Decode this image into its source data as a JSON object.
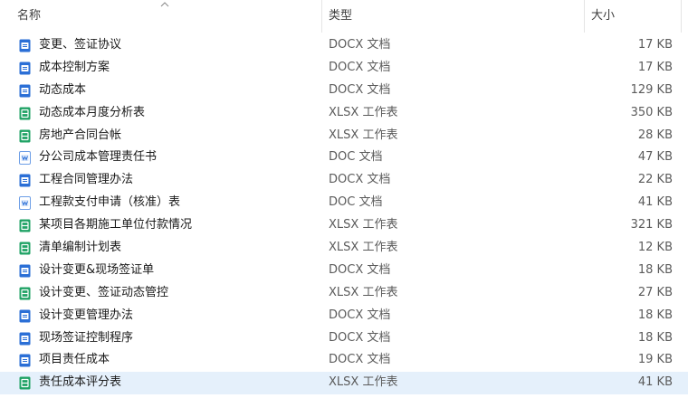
{
  "header": {
    "name_label": "名称",
    "type_label": "类型",
    "size_label": "大小",
    "sort": "ascending"
  },
  "colors": {
    "word": "#2b6fd6",
    "excel": "#21a366",
    "selected_row": "#e5f0fb"
  },
  "files": [
    {
      "name": "变更、签证协议",
      "type": "DOCX 文档",
      "size": "17 KB",
      "icon": "word-doc-icon"
    },
    {
      "name": "成本控制方案",
      "type": "DOCX 文档",
      "size": "17 KB",
      "icon": "word-doc-icon"
    },
    {
      "name": "动态成本",
      "type": "DOCX 文档",
      "size": "129 KB",
      "icon": "word-doc-icon"
    },
    {
      "name": "动态成本月度分析表",
      "type": "XLSX 工作表",
      "size": "350 KB",
      "icon": "excel-sheet-icon"
    },
    {
      "name": "房地产合同台帐",
      "type": "XLSX 工作表",
      "size": "28 KB",
      "icon": "excel-sheet-icon"
    },
    {
      "name": "分公司成本管理责任书",
      "type": "DOC 文档",
      "size": "47 KB",
      "icon": "word-doc-legacy-icon"
    },
    {
      "name": "工程合同管理办法",
      "type": "DOCX 文档",
      "size": "22 KB",
      "icon": "word-doc-icon"
    },
    {
      "name": "工程款支付申请（核准）表",
      "type": "DOC 文档",
      "size": "41 KB",
      "icon": "word-doc-legacy-icon"
    },
    {
      "name": "某项目各期施工单位付款情况",
      "type": "XLSX 工作表",
      "size": "321 KB",
      "icon": "excel-sheet-icon"
    },
    {
      "name": "清单编制计划表",
      "type": "XLSX 工作表",
      "size": "12 KB",
      "icon": "excel-sheet-icon"
    },
    {
      "name": "设计变更&现场签证单",
      "type": "DOCX 文档",
      "size": "18 KB",
      "icon": "word-doc-icon"
    },
    {
      "name": "设计变更、签证动态管控",
      "type": "XLSX 工作表",
      "size": "27 KB",
      "icon": "excel-sheet-icon"
    },
    {
      "name": "设计变更管理办法",
      "type": "DOCX 文档",
      "size": "18 KB",
      "icon": "word-doc-icon"
    },
    {
      "name": "现场签证控制程序",
      "type": "DOCX 文档",
      "size": "18 KB",
      "icon": "word-doc-icon"
    },
    {
      "name": "项目责任成本",
      "type": "DOCX 文档",
      "size": "19 KB",
      "icon": "word-doc-icon"
    },
    {
      "name": "责任成本评分表",
      "type": "XLSX 工作表",
      "size": "41 KB",
      "icon": "excel-sheet-icon",
      "selected": true
    }
  ]
}
